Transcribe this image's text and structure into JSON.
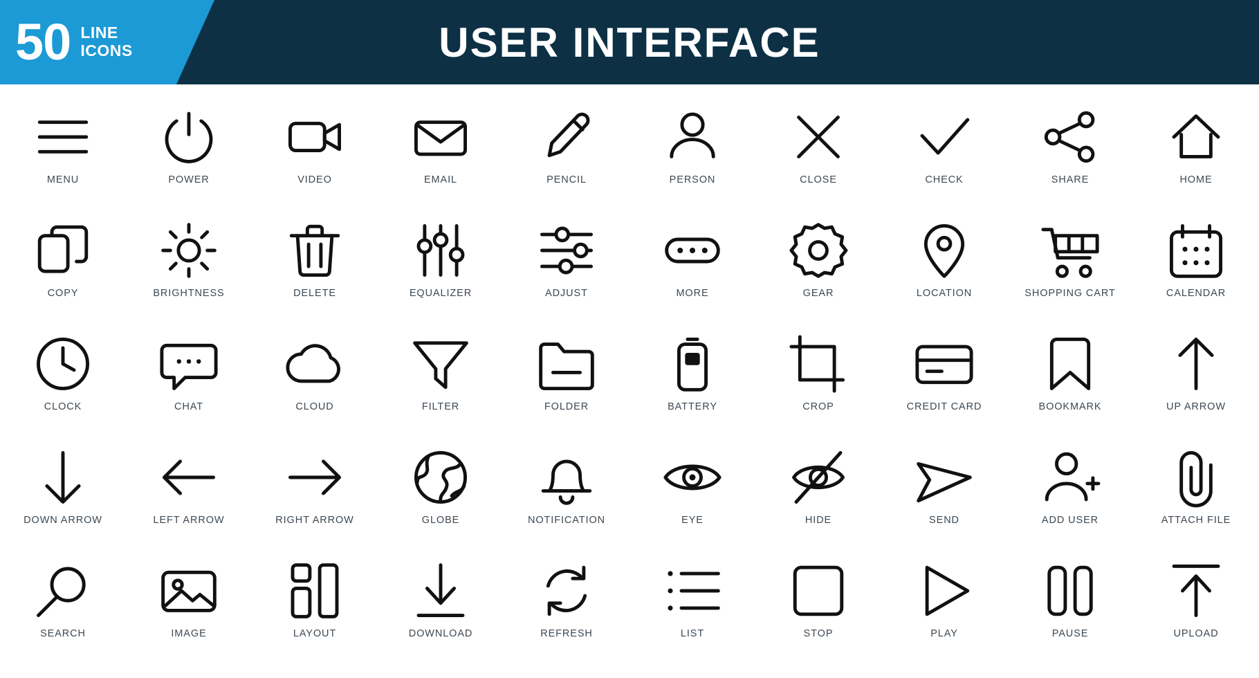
{
  "header": {
    "badge_number": "50",
    "badge_line1": "LINE",
    "badge_line2": "ICONS",
    "title": "USER INTERFACE",
    "badge_color": "#1b9ad6",
    "background_color": "#0d3044",
    "title_color": "#ffffff"
  },
  "style": {
    "icon_stroke_color": "#111111",
    "label_color": "#3d4852",
    "page_background": "#ffffff"
  },
  "icons": [
    {
      "label": "MENU",
      "icon": "menu-icon"
    },
    {
      "label": "POWER",
      "icon": "power-icon"
    },
    {
      "label": "VIDEO",
      "icon": "video-icon"
    },
    {
      "label": "EMAIL",
      "icon": "email-icon"
    },
    {
      "label": "PENCIL",
      "icon": "pencil-icon"
    },
    {
      "label": "PERSON",
      "icon": "person-icon"
    },
    {
      "label": "CLOSE",
      "icon": "close-icon"
    },
    {
      "label": "CHECK",
      "icon": "check-icon"
    },
    {
      "label": "SHARE",
      "icon": "share-icon"
    },
    {
      "label": "HOME",
      "icon": "home-icon"
    },
    {
      "label": "COPY",
      "icon": "copy-icon"
    },
    {
      "label": "BRIGHTNESS",
      "icon": "brightness-icon"
    },
    {
      "label": "DELETE",
      "icon": "delete-icon"
    },
    {
      "label": "EQUALIZER",
      "icon": "equalizer-icon"
    },
    {
      "label": "ADJUST",
      "icon": "adjust-icon"
    },
    {
      "label": "MORE",
      "icon": "more-icon"
    },
    {
      "label": "GEAR",
      "icon": "gear-icon"
    },
    {
      "label": "LOCATION",
      "icon": "location-icon"
    },
    {
      "label": "SHOPPING CART",
      "icon": "shopping-cart-icon"
    },
    {
      "label": "CALENDAR",
      "icon": "calendar-icon"
    },
    {
      "label": "CLOCK",
      "icon": "clock-icon"
    },
    {
      "label": "CHAT",
      "icon": "chat-icon"
    },
    {
      "label": "CLOUD",
      "icon": "cloud-icon"
    },
    {
      "label": "FILTER",
      "icon": "filter-icon"
    },
    {
      "label": "FOLDER",
      "icon": "folder-icon"
    },
    {
      "label": "BATTERY",
      "icon": "battery-icon"
    },
    {
      "label": "CROP",
      "icon": "crop-icon"
    },
    {
      "label": "CREDIT CARD",
      "icon": "credit-card-icon"
    },
    {
      "label": "BOOKMARK",
      "icon": "bookmark-icon"
    },
    {
      "label": "UP ARROW",
      "icon": "up-arrow-icon"
    },
    {
      "label": "DOWN ARROW",
      "icon": "down-arrow-icon"
    },
    {
      "label": "LEFT ARROW",
      "icon": "left-arrow-icon"
    },
    {
      "label": "RIGHT ARROW",
      "icon": "right-arrow-icon"
    },
    {
      "label": "GLOBE",
      "icon": "globe-icon"
    },
    {
      "label": "NOTIFICATION",
      "icon": "notification-icon"
    },
    {
      "label": "EYE",
      "icon": "eye-icon"
    },
    {
      "label": "HIDE",
      "icon": "hide-icon"
    },
    {
      "label": "SEND",
      "icon": "send-icon"
    },
    {
      "label": "ADD USER",
      "icon": "add-user-icon"
    },
    {
      "label": "ATTACH FILE",
      "icon": "attach-file-icon"
    },
    {
      "label": "SEARCH",
      "icon": "search-icon"
    },
    {
      "label": "IMAGE",
      "icon": "image-icon"
    },
    {
      "label": "LAYOUT",
      "icon": "layout-icon"
    },
    {
      "label": "DOWNLOAD",
      "icon": "download-icon"
    },
    {
      "label": "REFRESH",
      "icon": "refresh-icon"
    },
    {
      "label": "LIST",
      "icon": "list-icon"
    },
    {
      "label": "STOP",
      "icon": "stop-icon"
    },
    {
      "label": "PLAY",
      "icon": "play-icon"
    },
    {
      "label": "PAUSE",
      "icon": "pause-icon"
    },
    {
      "label": "UPLOAD",
      "icon": "upload-icon"
    }
  ]
}
